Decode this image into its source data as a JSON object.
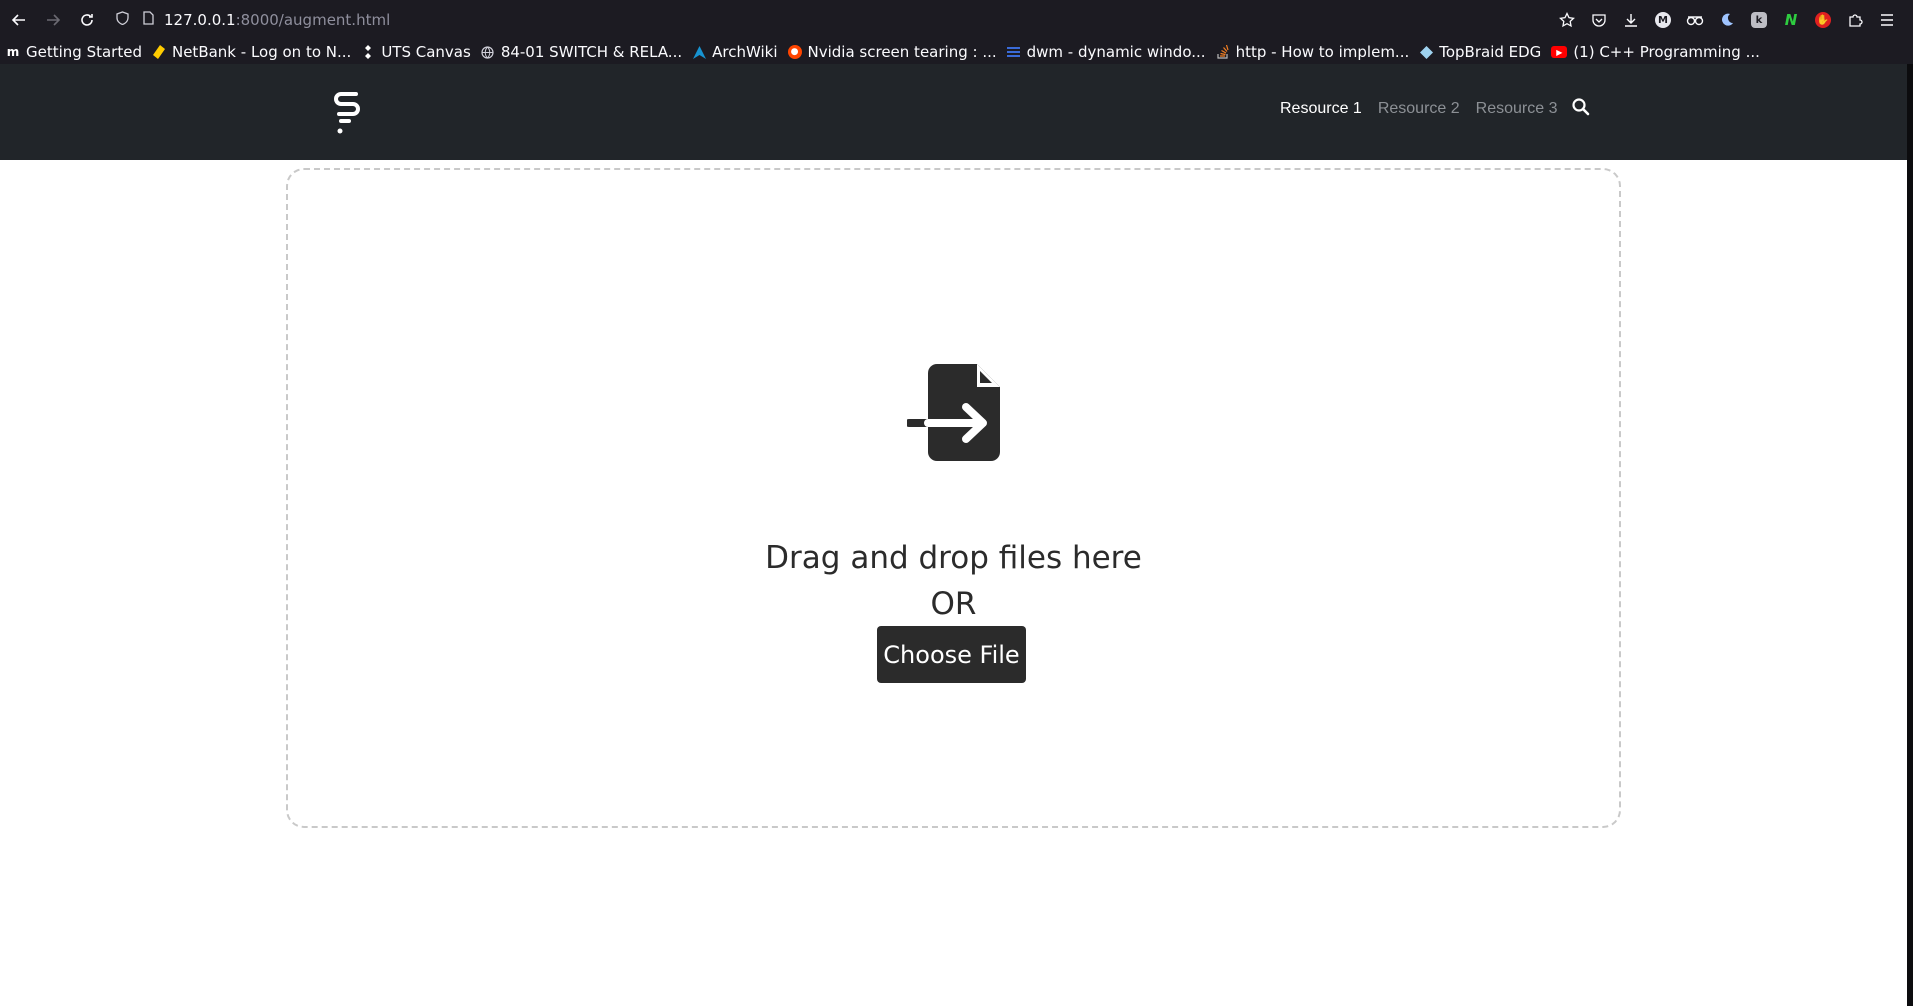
{
  "browser": {
    "url_host": "127.0.0.1",
    "url_rest": ":8000/augment.html"
  },
  "bookmarks": [
    {
      "label": "Getting Started",
      "icon": "mdn-icon",
      "color": "#ffffff"
    },
    {
      "label": "NetBank - Log on to N...",
      "icon": "netbank-icon",
      "color": "#ffcc00"
    },
    {
      "label": "UTS Canvas",
      "icon": "canvas-icon",
      "color": "#ffffff"
    },
    {
      "label": "84-01 SWITCH & RELA...",
      "icon": "globe-icon",
      "color": "#cfcfd8"
    },
    {
      "label": "ArchWiki",
      "icon": "arch-icon",
      "color": "#1793d1"
    },
    {
      "label": "Nvidia screen tearing : ...",
      "icon": "reddit-icon",
      "color": "#ff4500"
    },
    {
      "label": "dwm - dynamic windo...",
      "icon": "suckless-icon",
      "color": "#3a6bd8"
    },
    {
      "label": "http - How to implem...",
      "icon": "stackoverflow-icon",
      "color": "#f48024"
    },
    {
      "label": "TopBraid EDG",
      "icon": "topbraid-icon",
      "color": "#9fd3f0"
    },
    {
      "label": "(1) C++ Programming ...",
      "icon": "youtube-icon",
      "color": "#ff0000"
    }
  ],
  "header": {
    "nav": [
      {
        "label": "Resource 1",
        "active": true
      },
      {
        "label": "Resource 2",
        "active": false
      },
      {
        "label": "Resource 3",
        "active": false
      }
    ]
  },
  "dropzone": {
    "drag_text": "Drag and drop files here",
    "or_text": "OR",
    "button_label": "Choose File"
  },
  "colors": {
    "header_bg": "#212529",
    "button_bg": "#2b2b2b",
    "browser_bg": "#1c1b22"
  }
}
